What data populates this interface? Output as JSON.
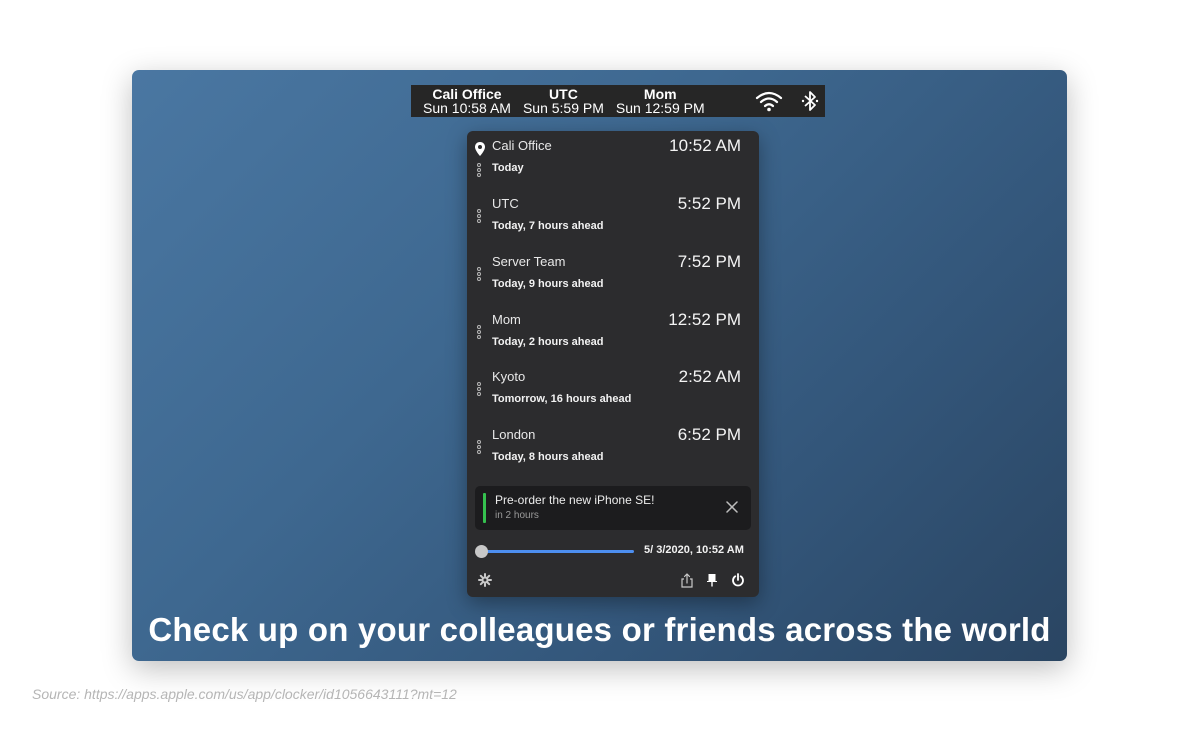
{
  "menubar": {
    "clocks": [
      {
        "name": "Cali Office",
        "time": "Sun 10:58 AM"
      },
      {
        "name": "UTC",
        "time": "Sun 5:59 PM"
      },
      {
        "name": "Mom",
        "time": "Sun 12:59 PM"
      }
    ],
    "icons": [
      "wifi-icon",
      "bluetooth-icon"
    ]
  },
  "panel": {
    "rows": [
      {
        "name": "Cali Office",
        "relative": "Today",
        "time": "10:52 AM",
        "icon": "location-pin-icon"
      },
      {
        "name": "UTC",
        "relative": "Today, 7 hours ahead",
        "time": "5:52 PM"
      },
      {
        "name": "Server Team",
        "relative": "Today, 9 hours ahead",
        "time": "7:52 PM"
      },
      {
        "name": "Mom",
        "relative": "Today, 2 hours ahead",
        "time": "12:52 PM"
      },
      {
        "name": "Kyoto",
        "relative": "Tomorrow, 16 hours ahead",
        "time": "2:52 AM"
      },
      {
        "name": "London",
        "relative": "Today, 8 hours ahead",
        "time": "6:52 PM"
      }
    ],
    "event": {
      "title": "Pre-order the new iPhone SE!",
      "subtitle": "in 2 hours",
      "accent": "#35c14f"
    },
    "slider": {
      "label": "5/  3/2020, 10:52 AM",
      "position": 0,
      "accent": "#4d8ff0"
    },
    "footer_icons": [
      "gear-icon",
      "share-icon",
      "pin-icon",
      "power-icon"
    ]
  },
  "caption": "Check up on your colleagues or friends across the world",
  "source": "Source: https://apps.apple.com/us/app/clocker/id1056643111?mt=12"
}
